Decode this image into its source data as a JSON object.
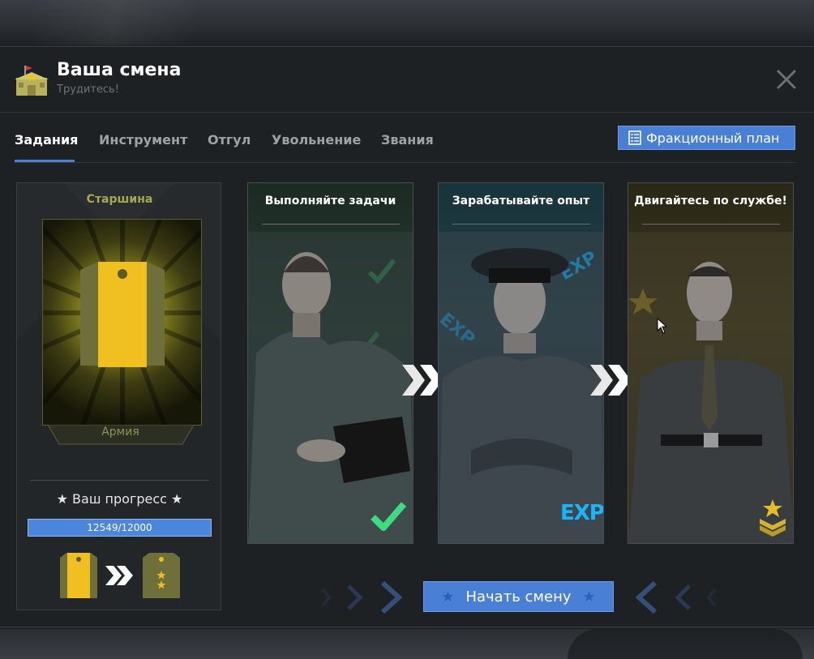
{
  "header": {
    "title": "Ваша смена",
    "subtitle": "Трудитесь!"
  },
  "tabs": [
    {
      "label": "Задания",
      "active": true
    },
    {
      "label": "Инструмент",
      "active": false
    },
    {
      "label": "Отгул",
      "active": false
    },
    {
      "label": "Увольнение",
      "active": false
    },
    {
      "label": "Звания",
      "active": false
    }
  ],
  "plan_button": {
    "label": "Фракционный план",
    "icon": "checklist-icon"
  },
  "rank": {
    "name": "Старшина",
    "faction": "Армия",
    "progress_label": "★ Ваш прогресс ★",
    "progress_text": "12549/12000",
    "progress_current": 12549,
    "progress_max": 12000,
    "insignia_color": "#f0c020"
  },
  "steps": [
    {
      "title": "Выполняйте задачи",
      "badge_icon": "checkmark-icon",
      "badge_color": "#3ddc84"
    },
    {
      "title": "Зарабатывайте опыт",
      "badge": "EXP",
      "badge_color": "#19b6ff"
    },
    {
      "title": "Двигайтесь по службе!",
      "badge_icon": "rank-chevron-star-icon",
      "badge_color": "#d4b233"
    }
  ],
  "start_button": {
    "label": "Начать смену"
  },
  "colors": {
    "accent": "#4a7fd6",
    "panel": "#1e2124",
    "rank_text": "#a6a854"
  }
}
